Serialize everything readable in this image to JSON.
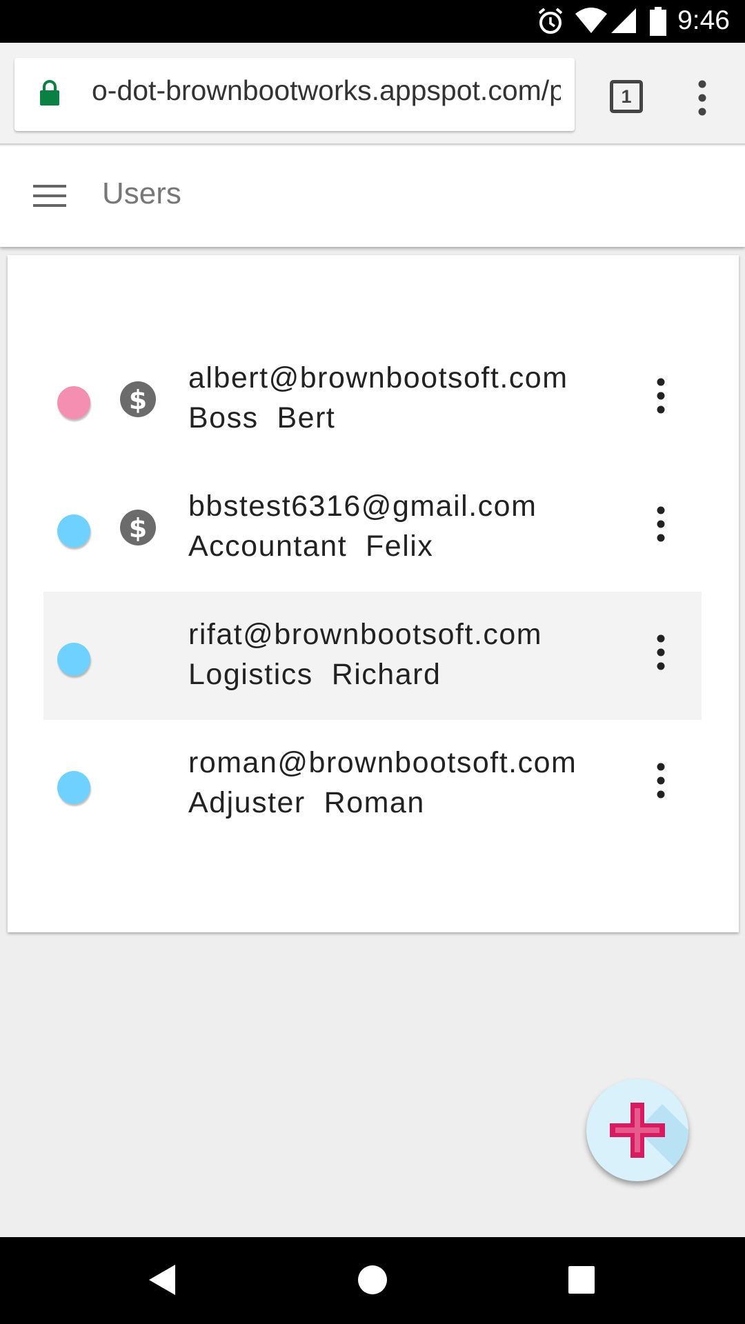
{
  "status_bar": {
    "time": "9:46",
    "icons": [
      "alarm-icon",
      "wifi-icon",
      "signal-icon",
      "battery-icon"
    ]
  },
  "browser": {
    "url": "o-dot-brownbootworks.appspot.com/p",
    "tab_count": "1",
    "icons": [
      "lock-icon",
      "tab-switcher-icon",
      "overflow-menu-icon"
    ],
    "lock_color": "#0b8043"
  },
  "app_bar": {
    "title": "Users",
    "menu_icon": "hamburger-icon"
  },
  "users": [
    {
      "email": "albert@brownbootsoft.com",
      "name": "Boss  Bert",
      "dot_color": "#f48fb1",
      "billing_icon": true,
      "selected": false
    },
    {
      "email": "bbstest6316@gmail.com",
      "name": "Accountant  Felix",
      "dot_color": "#6fd1ff",
      "billing_icon": true,
      "selected": false
    },
    {
      "email": "rifat@brownbootsoft.com",
      "name": "Logistics  Richard",
      "dot_color": "#6fd1ff",
      "billing_icon": false,
      "selected": true
    },
    {
      "email": "roman@brownbootsoft.com",
      "name": "Adjuster  Roman",
      "dot_color": "#6fd1ff",
      "billing_icon": false,
      "selected": false
    }
  ],
  "fab": {
    "icon": "add-icon",
    "color": "#d81b60"
  },
  "nav_bar": {
    "icons": [
      "back-icon",
      "home-icon",
      "recents-icon"
    ]
  }
}
